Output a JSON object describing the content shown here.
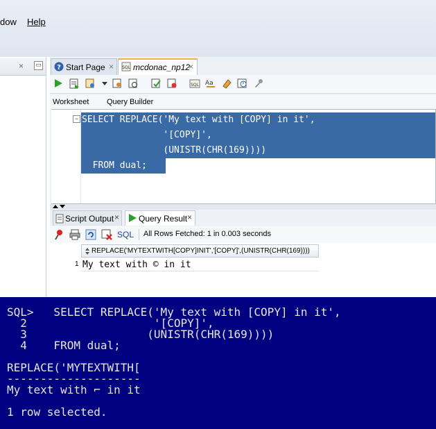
{
  "menu": {
    "items": [
      "dow",
      "Help"
    ]
  },
  "left_pane": {
    "close": "×",
    "minimize": "▭"
  },
  "tabs": [
    {
      "label": "Start Page",
      "close": "×"
    },
    {
      "label": "mcdonac_np12",
      "close": "×"
    }
  ],
  "subtabs": {
    "worksheet": "Worksheet",
    "query_builder": "Query Builder"
  },
  "editor": {
    "lines": [
      "SELECT REPLACE('My text with [COPY] in it',",
      "               '[COPY]',",
      "               (UNISTR(CHR(169))))",
      "  FROM dual;"
    ],
    "fold": "−"
  },
  "results_tabs": [
    {
      "label": "Script Output",
      "close": "×"
    },
    {
      "label": "Query Result",
      "close": "×"
    }
  ],
  "results_toolbar": {
    "sql_label": "SQL",
    "status": "All Rows Fetched: 1 in 0.003 seconds"
  },
  "grid": {
    "column": "REPLACE('MYTEXTWITH[COPY]INIT','[COPY]',(UNISTR(CHR(169))))",
    "rows": [
      {
        "num": "1",
        "value": "My text with © in it"
      }
    ]
  },
  "terminal": {
    "lines": [
      "SQL>   SELECT REPLACE('My text with [COPY] in it',",
      "  2                   '[COPY]',",
      "  3                  (UNISTR(CHR(169))))",
      "  4    FROM dual;",
      "",
      "REPLACE('MYTEXTWITH[",
      "--------------------",
      "My text with ⌐ in it",
      "",
      "1 row selected."
    ]
  },
  "colors": {
    "selection": "#3a6aa5",
    "terminal_bg": "#000080",
    "active_tab_accent": "#f0b33c"
  }
}
